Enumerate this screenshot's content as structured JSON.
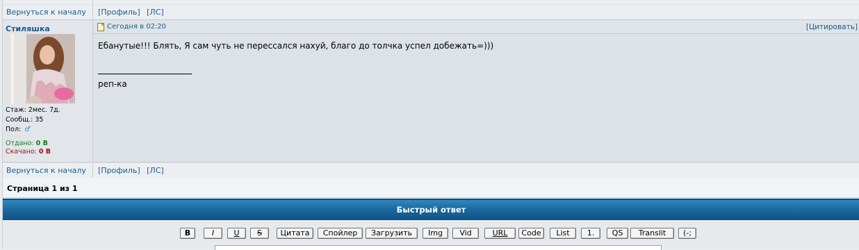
{
  "nav": {
    "back_to_top": "Вернуться к началу",
    "profile": "[Профиль]",
    "pm": "[ЛС]"
  },
  "post": {
    "author": "Стиляшка",
    "date": "Сегодня в 02:20",
    "quote": "[Цитировать]",
    "text": "Ебанутые!!! Блять, Я сам чуть не пересcался нахуй, благо до толчка успел добежать=)))",
    "signature_line": "__________________",
    "signature": "реп-ка",
    "stats": {
      "tenure_label": "Стаж:",
      "tenure": "2мес. 7д.",
      "messages_label": "Сообщ.:",
      "messages": "35",
      "gender_label": "Пол:",
      "given_label": "Отдано:",
      "given": "0 B",
      "downloaded_label": "Скачано:",
      "downloaded": "0 B"
    }
  },
  "pager": {
    "text": "Страница 1 из 1"
  },
  "quick_reply": {
    "title": "Быстрый ответ",
    "buttons": [
      "B",
      "I",
      "U",
      "S",
      "Цитата",
      "Спойлер",
      "Загрузить",
      "Img",
      "Vid",
      "URL",
      "Code",
      "List",
      "1.",
      "QS",
      "Translit",
      "(-;"
    ]
  },
  "colors": {
    "link": "#1b5a8a",
    "header_blue": "#1b6aa0",
    "given_green": "#1a7a1a",
    "downloaded_red": "#a01010"
  },
  "icons": {
    "post_marker": "doc-icon",
    "gender": "male-icon"
  }
}
